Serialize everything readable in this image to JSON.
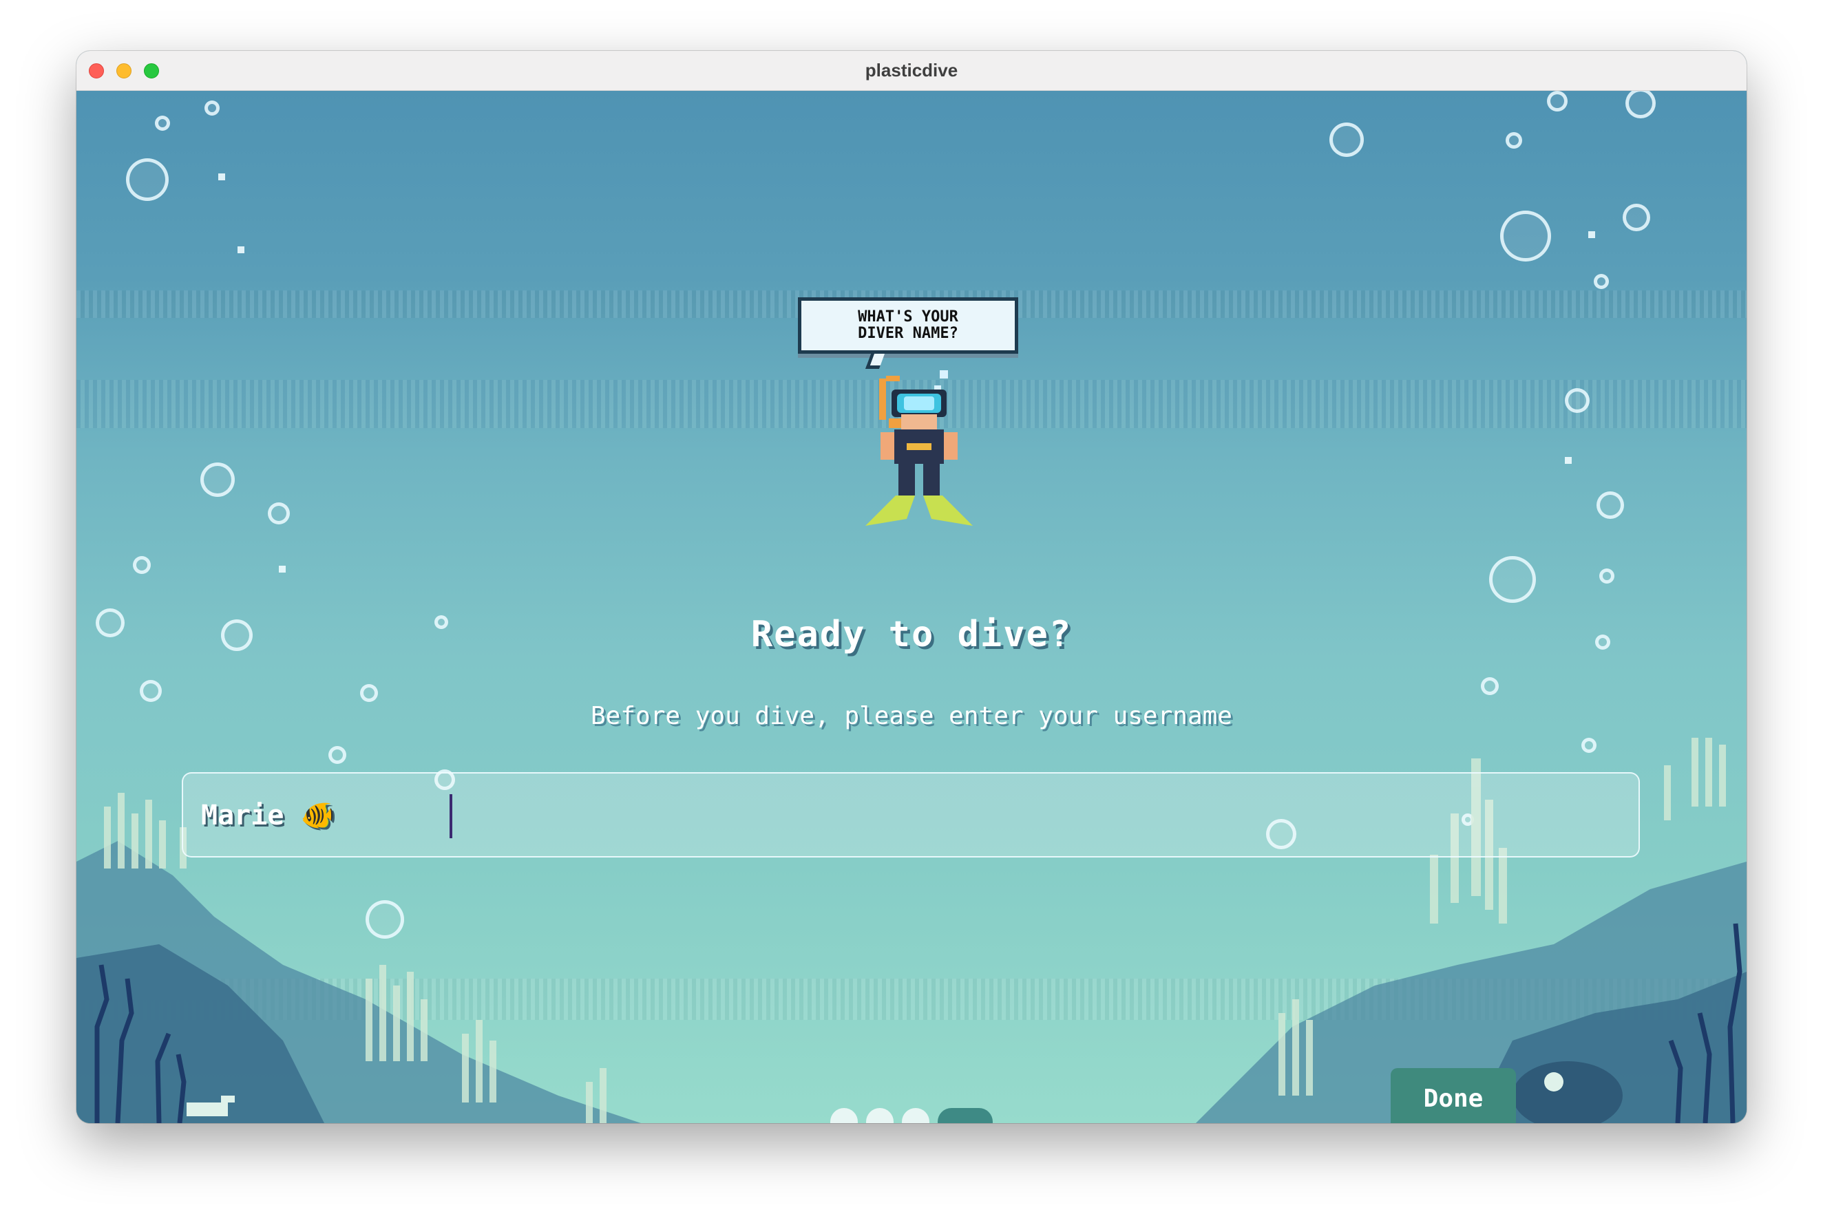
{
  "window": {
    "title": "plasticdive"
  },
  "speech_bubble": {
    "line1": "WHAT'S YOUR",
    "line2": "DIVER NAME?"
  },
  "heading": "Ready to dive?",
  "subheading": "Before you dive, please enter your username",
  "username_input": {
    "value": "Marie 🐠"
  },
  "pagination": {
    "total": 4,
    "current": 4
  },
  "done_button": {
    "label": "Done"
  },
  "colors": {
    "accent": "#3f8a7d",
    "water_top": "#4f93b3",
    "water_bottom": "#97dbcc"
  }
}
